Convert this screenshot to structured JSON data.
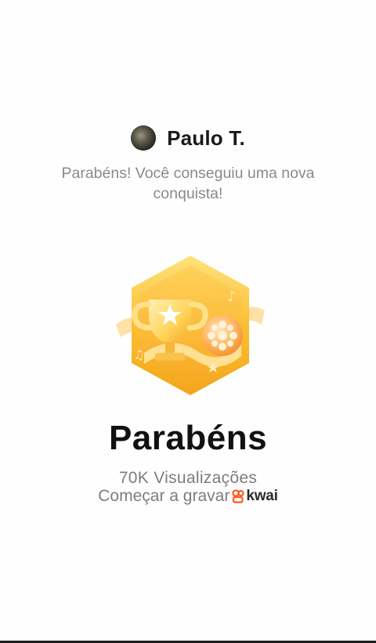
{
  "user": {
    "name": "Paulo T."
  },
  "message": "Parabéns! Você conseguiu uma nova conquista!",
  "badge": {
    "icon": "trophy-film-reel-badge-icon",
    "colors": {
      "base": "#F8B62A",
      "light": "#FFDF7A",
      "dark": "#E89A12"
    }
  },
  "headline": "Parabéns",
  "achievement": "70K Visualizações",
  "cta": {
    "text": "Começar a gravar",
    "brand": "kwai",
    "brand_color": "#FF5A1F"
  }
}
